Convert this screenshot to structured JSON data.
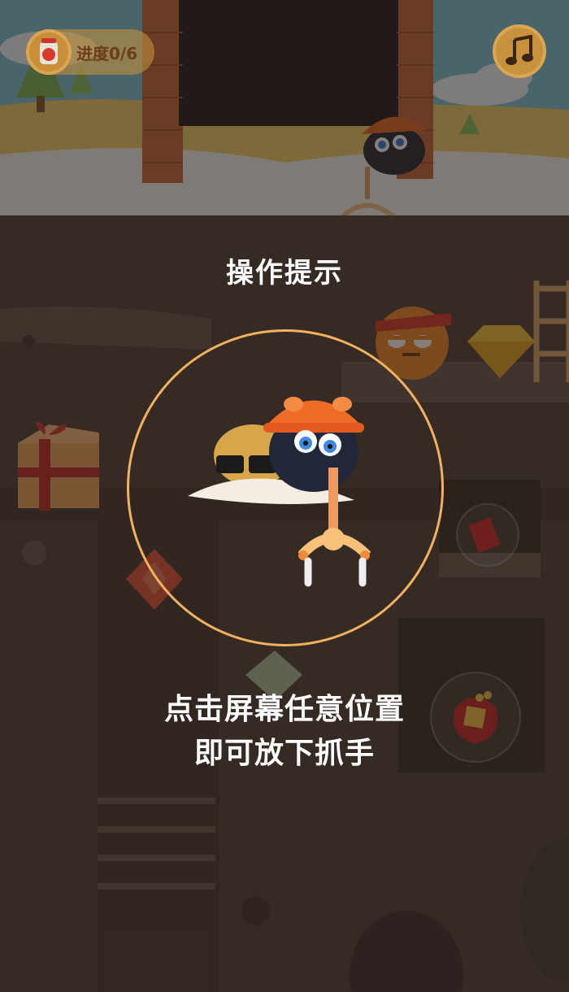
{
  "hud": {
    "progress_label": "进度0/6",
    "progress_icon": "jar-icon",
    "music_icon": "music-note-icon"
  },
  "tutorial": {
    "title": "操作提示",
    "instruction_line1": "点击屏幕任意位置",
    "instruction_line2": "即可放下抓手"
  },
  "colors": {
    "accent": "#f2b15e",
    "underground": "#4a3a33",
    "sky": "#7dc4d8",
    "overlay_text": "#ffffff"
  }
}
